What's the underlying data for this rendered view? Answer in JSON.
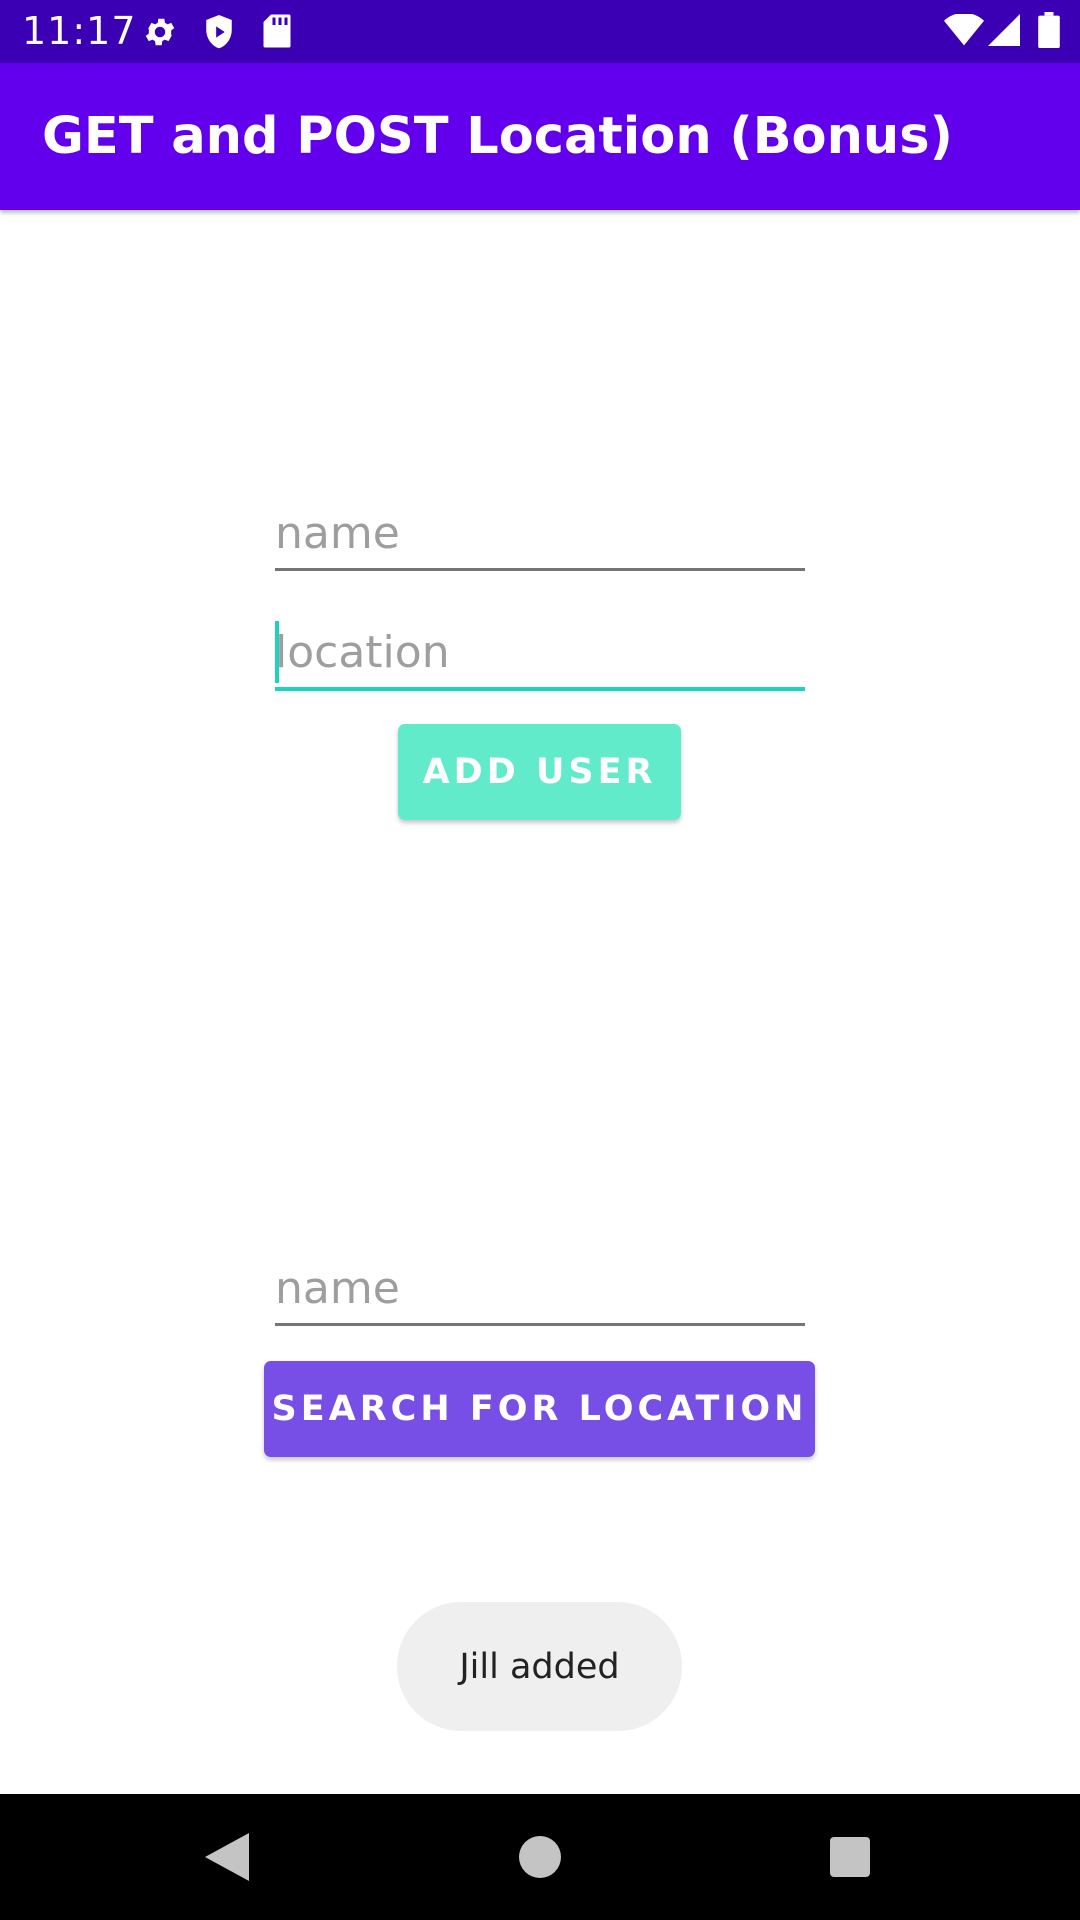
{
  "status_bar": {
    "time": "11:17",
    "left_icons": [
      "gear-icon",
      "shield-icon",
      "sd-card-icon"
    ],
    "right_icons": [
      "wifi-icon",
      "signal-icon",
      "battery-icon"
    ],
    "background": "#3b00b3"
  },
  "app_bar": {
    "title": "GET and POST Location (Bonus)",
    "background": "#6200ee"
  },
  "add_form": {
    "name_placeholder": "name",
    "location_placeholder": "location",
    "add_button_label": "ADD USER",
    "add_button_color": "#62ebcb"
  },
  "search_form": {
    "name_placeholder": "name",
    "search_button_label": "SEARCH FOR LOCATION",
    "search_button_color": "#774ee6"
  },
  "toast": {
    "message": "Jill added"
  },
  "nav_bar": {
    "buttons": [
      "back-icon",
      "home-icon",
      "recents-icon"
    ]
  }
}
